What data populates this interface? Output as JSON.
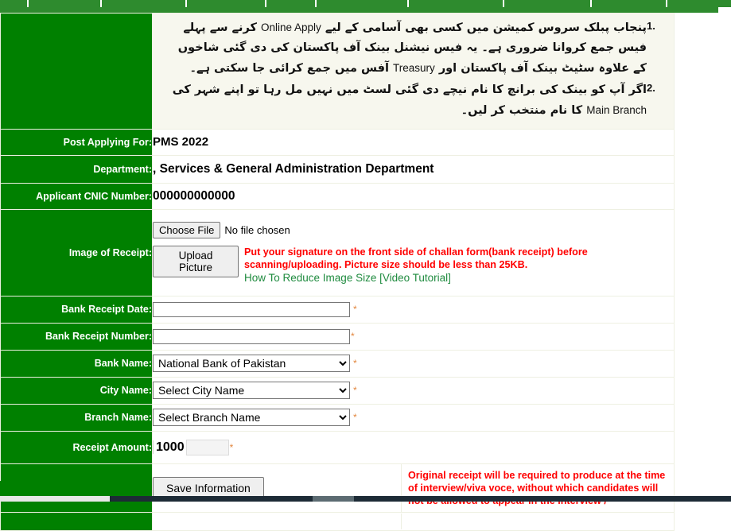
{
  "topnav": {
    "cells": [
      {
        "name": "nav-item-1",
        "width": 36
      },
      {
        "name": "nav-item-2",
        "width": 92
      },
      {
        "name": "nav-item-3",
        "width": 107
      },
      {
        "name": "nav-item-4",
        "width": 100
      },
      {
        "name": "nav-item-5",
        "width": 63
      },
      {
        "name": "nav-item-6",
        "width": 116
      },
      {
        "name": "nav-item-7",
        "width": 120
      },
      {
        "name": "nav-item-8",
        "width": 110
      },
      {
        "name": "nav-item-9",
        "width": 95
      },
      {
        "name": "nav-item-10",
        "width": 80
      }
    ]
  },
  "instructions": {
    "items": [
      {
        "number": "1.",
        "text_before_en1": "پنجاب پبلک سروس کمیشن میں کسی بھی آسامی کے لیے ",
        "en1": "Online Apply",
        "text_mid": " کرنے سے پہلے فیس جمع کروانا ضروری ہے۔ یہ فیس نیشنل بینک آف پاکستان کی دی گئی شاخوں کے علاوہ سٹیٹ بینک آف پاکستان اور ",
        "en2": "Treasury",
        "text_after": " آفس میں جمع کرائی جا سکتی ہے۔"
      },
      {
        "number": "2.",
        "text_before_en1": "اگر آپ کو بینک کی برانچ کا نام نیچے دی گئی لسٹ میں نہیں مل رہا تو اپنے شہر کی ",
        "en1": "Main Branch",
        "text_mid": " کا نام منتخب کر لیں۔",
        "en2": "",
        "text_after": ""
      }
    ]
  },
  "form": {
    "post_applying_label": "Post Applying For:",
    "post_applying_value": "PMS 2022",
    "department_label": "Department:",
    "department_value": ", Services & General Administration Department",
    "cnic_label": "Applicant CNIC Number:",
    "cnic_value": "000000000000",
    "image_receipt_label": "Image of Receipt:",
    "choose_file_label": "Choose File",
    "no_file_chosen": "No file chosen",
    "upload_picture_label": "Upload Picture",
    "upload_warning": "Put your signature on the front side of challan form(bank receipt) before scanning/uploading. Picture size should be less than 25KB.",
    "reduce_size_link": "How To Reduce Image Size [Video Tutorial]",
    "receipt_date_label": "Bank Receipt Date:",
    "receipt_date_value": "",
    "receipt_date_placeholder": "",
    "receipt_number_label": "Bank Receipt Number:",
    "receipt_number_value": "",
    "receipt_number_placeholder": "",
    "bank_name_label": "Bank Name:",
    "bank_name_selected": "National Bank of Pakistan",
    "city_name_label": "City Name:",
    "city_name_selected": "Select City Name",
    "branch_name_label": "Branch Name:",
    "branch_name_selected": "Select Branch Name",
    "receipt_amount_label": "Receipt Amount:",
    "receipt_amount_value": "1000",
    "receipt_amount_input": "",
    "save_label": "Save Information",
    "required_marker": "*",
    "original_receipt_note": "Original receipt will be  required to produce at the time of interview/viva voce, without which candidates will not be allowed to appear in  the interview /"
  },
  "colors": {
    "label_green": "#008000",
    "nav_green": "#2e8b2e",
    "warning_red": "#ff0000",
    "link_green": "#1f8b3f",
    "required_orange": "#e2863e",
    "urdu_bg": "#f7f7ee"
  }
}
